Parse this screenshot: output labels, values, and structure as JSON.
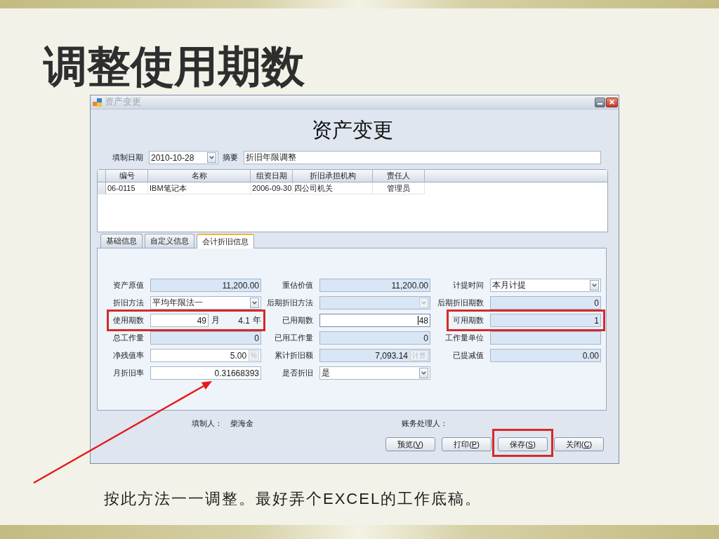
{
  "slide": {
    "title": "调整使用期数",
    "caption": "按此方法一一调整。最好弄个EXCEL的工作底稿。"
  },
  "window": {
    "title": "资产变更",
    "heading": "资产变更",
    "header_fields": [
      {
        "label": "填制日期",
        "kind": "dropdown",
        "value": "2010-10-28"
      },
      {
        "label": "摘要",
        "kind": "text",
        "value": "折旧年限调整"
      }
    ],
    "grid": {
      "columns": [
        "编号",
        "名称",
        "组资日期",
        "折旧承担机构",
        "责任人"
      ],
      "rows": [
        [
          "06-0115",
          "IBM笔记本",
          "2006-09-30",
          "四公司机关",
          "管理员"
        ]
      ]
    },
    "tabs": [
      {
        "label": "基础信息",
        "selected": false
      },
      {
        "label": "自定义信息",
        "selected": false
      },
      {
        "label": "会计折旧信息",
        "selected": true
      }
    ],
    "form_fields": [
      {
        "label": "资产原值",
        "kind": "text",
        "value": "11,200.00",
        "readonly": true,
        "focused": false,
        "highlighted": false
      },
      {
        "label": "重估价值",
        "kind": "text",
        "value": "11,200.00",
        "readonly": true,
        "focused": false,
        "highlighted": false
      },
      {
        "label": "计提时间",
        "kind": "dropdown",
        "value": "本月计提",
        "readonly": false,
        "focused": false,
        "highlighted": false
      },
      {
        "label": "折旧方法",
        "kind": "dropdown",
        "value": "平均年限法一",
        "readonly": false,
        "focused": false,
        "highlighted": false
      },
      {
        "label": "后期折旧方法",
        "kind": "dropdown",
        "readonly": true,
        "focused": false,
        "highlighted": false
      },
      {
        "label": "后期折旧期数",
        "kind": "text",
        "value": "0",
        "readonly": true,
        "focused": false,
        "highlighted": false
      },
      {
        "label": "使用期数",
        "kind": "period",
        "value": "49",
        "unit": "月",
        "years": "4.1",
        "years_unit": "年",
        "readonly": false,
        "focused": false,
        "highlighted": true
      },
      {
        "label": "已用期数",
        "kind": "text",
        "value": "48",
        "readonly": false,
        "focused": true,
        "highlighted": false
      },
      {
        "label": "可用期数",
        "kind": "text",
        "value": "1",
        "readonly": true,
        "focused": false,
        "highlighted": true
      },
      {
        "label": "总工作量",
        "kind": "text",
        "value": "0",
        "readonly": true,
        "focused": false,
        "highlighted": false
      },
      {
        "label": "已用工作量",
        "kind": "text",
        "value": "0",
        "readonly": true,
        "focused": false,
        "highlighted": false
      },
      {
        "label": "工作量单位",
        "kind": "text",
        "readonly": true,
        "focused": false,
        "highlighted": false
      },
      {
        "label": "净残值率",
        "kind": "text_button",
        "value": "5.00",
        "button": "%",
        "button_disabled": true,
        "readonly": false,
        "focused": false,
        "highlighted": false
      },
      {
        "label": "累计折旧额",
        "kind": "text_button",
        "value": "7,093.14",
        "button": "计算",
        "button_disabled": true,
        "readonly": true,
        "focused": false,
        "highlighted": false
      },
      {
        "label": "已提减值",
        "kind": "text",
        "value": "0.00",
        "readonly": true,
        "focused": false,
        "highlighted": false
      },
      {
        "label": "月折旧率",
        "kind": "text",
        "value": "0.31668393",
        "readonly": false,
        "focused": false,
        "highlighted": false
      },
      {
        "label": "是否折旧",
        "kind": "dropdown",
        "value": "是",
        "readonly": false,
        "focused": false,
        "highlighted": false
      }
    ],
    "footer": [
      {
        "label": "填制人：",
        "value": "柴海金"
      },
      {
        "label": "账务处理人："
      }
    ],
    "buttons": [
      {
        "label_before": "预览(",
        "access_key": "V",
        "label_after": ")",
        "highlighted": false
      },
      {
        "label_before": "打印(",
        "access_key": "P",
        "label_after": ")",
        "highlighted": false
      },
      {
        "label_before": "保存(",
        "access_key": "S",
        "label_after": ")",
        "highlighted": true
      },
      {
        "label_before": "关闭(",
        "access_key": "C",
        "label_after": ")",
        "highlighted": false
      }
    ]
  }
}
